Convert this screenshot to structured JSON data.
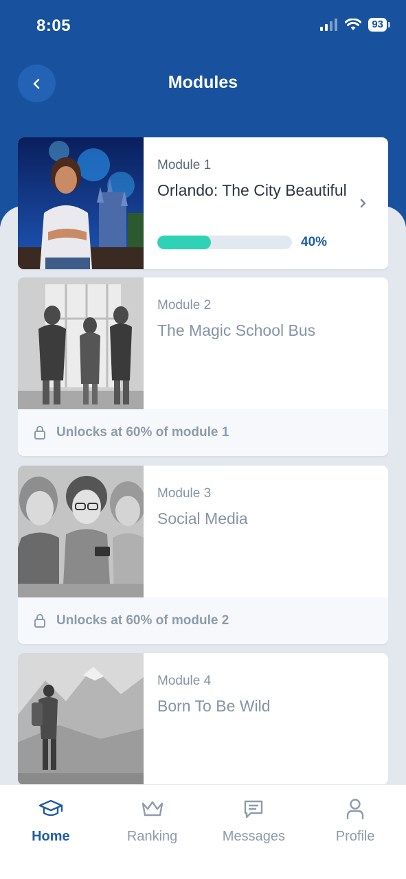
{
  "status": {
    "time": "8:05",
    "battery": "93"
  },
  "header": {
    "title": "Modules"
  },
  "modules": [
    {
      "number": "Module 1",
      "title": "Orlando: The City Beautiful",
      "progress": 0.4,
      "progress_label": "40%"
    },
    {
      "number": "Module 2",
      "title": "The Magic School Bus",
      "lock_text": "Unlocks at 60% of module 1"
    },
    {
      "number": "Module 3",
      "title": "Social Media",
      "lock_text": "Unlocks at 60% of module 2"
    },
    {
      "number": "Module 4",
      "title": "Born To Be Wild"
    }
  ],
  "tabs": [
    {
      "label": "Home",
      "icon": "graduation-cap-icon",
      "active": true
    },
    {
      "label": "Ranking",
      "icon": "crown-icon"
    },
    {
      "label": "Messages",
      "icon": "message-icon"
    },
    {
      "label": "Profile",
      "icon": "user-icon"
    }
  ],
  "colors": {
    "primary": "#18529f",
    "accent": "#2fd2b6",
    "background": "#e3e8ef"
  }
}
